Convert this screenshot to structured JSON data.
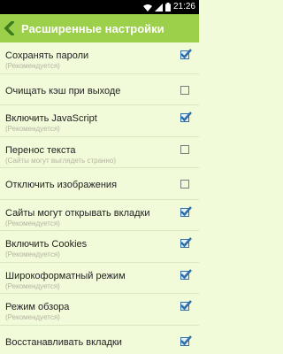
{
  "status_bar": {
    "time": "21:26"
  },
  "app_bar": {
    "title": "Расширенные настройки",
    "back_icon": "back-arrow-icon"
  },
  "settings": [
    {
      "label": "Сохранять пароли",
      "sub": "(Рекомендуется)",
      "checked": true
    },
    {
      "label": "Очищать кэш при выходе",
      "sub": "",
      "checked": false
    },
    {
      "label": "Включить JavaScript",
      "sub": "(Рекомендуется)",
      "checked": true
    },
    {
      "label": "Перенос текста",
      "sub": "(Сайты могут выглядеть странно)",
      "checked": false
    },
    {
      "label": "Отключить изображения",
      "sub": "",
      "checked": false
    },
    {
      "label": "Сайты могут открывать вкладки",
      "sub": "(Рекомендуется)",
      "checked": true
    },
    {
      "label": "Включить Cookies",
      "sub": "(Рекомендуется)",
      "checked": true
    },
    {
      "label": "Широкоформатный режим",
      "sub": "(Рекомендуется)",
      "checked": true
    },
    {
      "label": "Режим обзора",
      "sub": "(Рекомендуется)",
      "checked": true
    },
    {
      "label": "Восстанавливать вкладки",
      "sub": "",
      "checked": true
    }
  ],
  "colors": {
    "appbar": "#9ccf4a",
    "background": "#f2fbd9",
    "checkmark": "#2f6fa8"
  }
}
